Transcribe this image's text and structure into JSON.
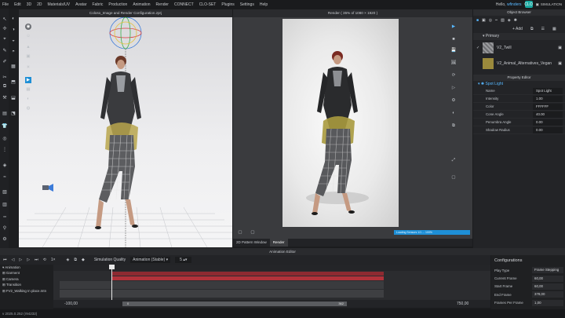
{
  "menu": [
    "File",
    "Edit",
    "3D",
    "2D",
    "Materials/UV",
    "Avatar",
    "Fabric",
    "Production",
    "Animation",
    "Render",
    "CONNECT",
    "CLO-SET",
    "Plugins",
    "Settings",
    "Help"
  ],
  "user": {
    "greeting": "Hello,",
    "name": "wfinders",
    "logo": "CLO",
    "mode": "SIMULATION"
  },
  "viewport3d": {
    "title": "Coloso_Image and Render Configuration.zprj"
  },
  "render": {
    "title": "Render ( 35% of 1080 × 1920 )",
    "progress_text": "Loading Sensors 1/1 ... 100%",
    "tabs": [
      "2D Pattern Window",
      "Render"
    ]
  },
  "object_browser": {
    "title": "Object Browser",
    "add_label": "+ Add",
    "section": "Primary",
    "fabrics": [
      {
        "name": "V2_Twill",
        "color": "#8d8e90"
      },
      {
        "name": "V2_Animal_Alternatives_Vegan",
        "color": "#9b8a3c"
      }
    ]
  },
  "property_editor": {
    "title": "Property Editor",
    "node": "Spot Light",
    "rows": [
      {
        "label": "Name",
        "value": "Spot Light"
      },
      {
        "label": "Intensity",
        "value": "1.00"
      },
      {
        "label": "Color",
        "value": "FFFFFF"
      },
      {
        "label": "Cone Angle",
        "value": "40.00"
      },
      {
        "label": "Penumbra Angle",
        "value": "0.00"
      },
      {
        "label": "Shadow Radius",
        "value": "0.00"
      }
    ]
  },
  "animation": {
    "title": "Animation Editor",
    "quality_label": "Simulation Quality",
    "quality_value": "Animation (Stable)",
    "fps_value": "5",
    "tree": [
      "Animation",
      "Garment",
      "Camera",
      "Transition",
      "FV2_Walking In place.mtn"
    ],
    "footer": {
      "left": "-100,00",
      "start": "0",
      "end": "362",
      "right": "750,00"
    }
  },
  "configurations": {
    "title": "Configurations",
    "rows": [
      {
        "label": "Play Type",
        "value": "Frame Stepping"
      },
      {
        "label": "Current Frame",
        "value": "60,00"
      },
      {
        "label": "Start Frame",
        "value": "60,00"
      },
      {
        "label": "End Frame",
        "value": "378,00"
      },
      {
        "label": "Frames Per Frame",
        "value": "1,00"
      }
    ]
  },
  "status": {
    "text": "v 2025.0.252 (r94232)"
  },
  "colors": {
    "accent": "#1e8fd6",
    "track_red": "#b2323a",
    "panel": "#232427"
  }
}
